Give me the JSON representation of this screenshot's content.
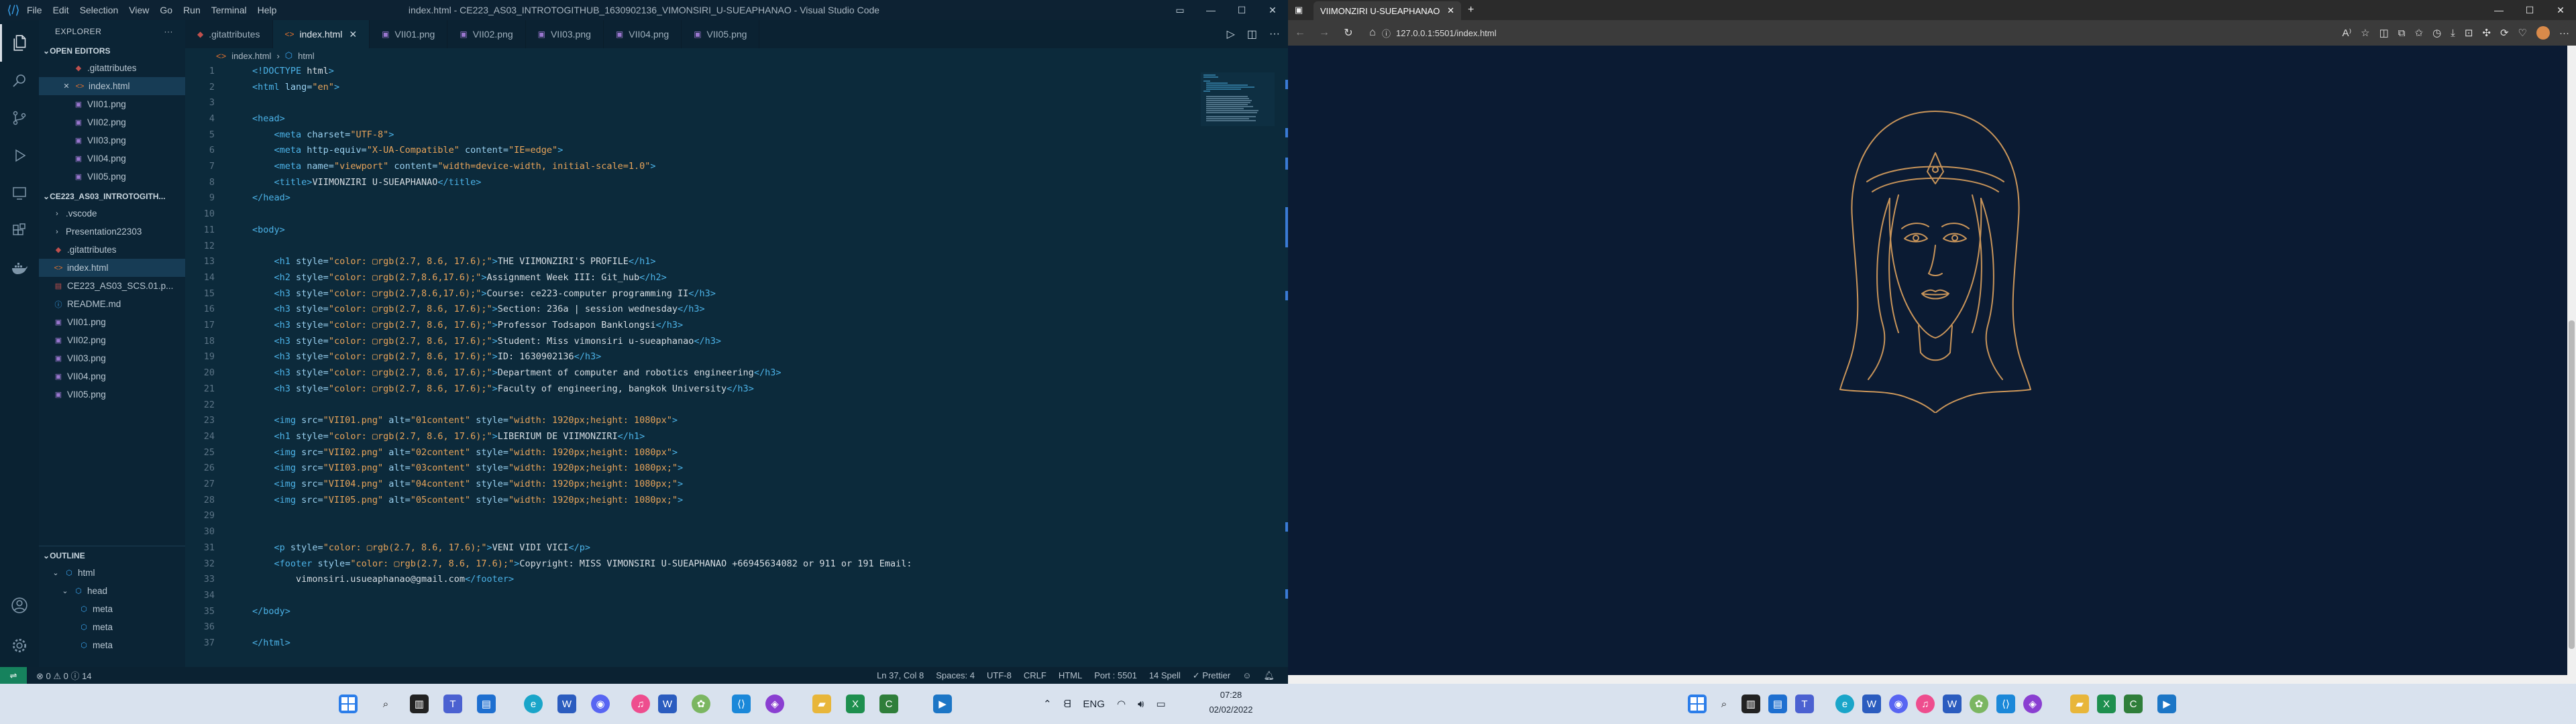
{
  "vscode": {
    "window_title": "index.html - CE223_AS03_INTROTOGITHUB_1630902136_VIMONSIRI_U-SUEAPHANAO - Visual Studio Code",
    "menu": [
      "File",
      "Edit",
      "Selection",
      "View",
      "Go",
      "Run",
      "Terminal",
      "Help"
    ],
    "explorer_title": "EXPLORER",
    "open_editors_title": "OPEN EDITORS",
    "open_editors": [
      ".gitattributes",
      "index.html",
      "VII01.png",
      "VII02.png",
      "VII03.png",
      "VII04.png",
      "VII05.png"
    ],
    "workspace_title": "CE223_AS03_INTROTOGITH...",
    "workspace_items": [
      ".vscode",
      "Presentation22303",
      ".gitattributes",
      "index.html",
      "CE223_AS03_SCS.01.p...",
      "README.md",
      "VII01.png",
      "VII02.png",
      "VII03.png",
      "VII04.png",
      "VII05.png"
    ],
    "outline_title": "OUTLINE",
    "outline_items": [
      "html",
      "head",
      "meta",
      "meta",
      "meta"
    ],
    "tabs": [
      ".gitattributes",
      "index.html",
      "VII01.png",
      "VII02.png",
      "VII03.png",
      "VII04.png",
      "VII05.png"
    ],
    "breadcrumb": [
      "index.html",
      "html"
    ],
    "status": {
      "errors": "⊗ 0 ⚠ 0 ⓘ 14",
      "position": "Ln 37, Col 8",
      "spaces": "Spaces: 4",
      "encoding": "UTF-8",
      "eol": "CRLF",
      "language": "HTML",
      "port": "Port : 5501",
      "spell": "14 Spell",
      "prettier": "✓ Prettier"
    }
  },
  "code_lines": [
    "<!DOCTYPE html>",
    "<html lang=\"en\">",
    "",
    "<head>",
    "    <meta charset=\"UTF-8\">",
    "    <meta http-equiv=\"X-UA-Compatible\" content=\"IE=edge\">",
    "    <meta name=\"viewport\" content=\"width=device-width, initial-scale=1.0\">",
    "    <title>VIIMONZIRI U-SUEAPHANAO</title>",
    "</head>",
    "",
    "<body>",
    "",
    "    <h1 style=\"color: ▢rgb(2.7, 8.6, 17.6);\">THE VIIMONZIRI'S PROFILE</h1>",
    "    <h2 style=\"color: ▢rgb(2.7,8.6,17.6);\">Assignment Week III: Git_hub</h2>",
    "    <h3 style=\"color: ▢rgb(2.7,8.6,17.6);\">Course: ce223-computer programming II</h3>",
    "    <h3 style=\"color: ▢rgb(2.7, 8.6, 17.6);\">Section: 236a | session wednesday</h3>",
    "    <h3 style=\"color: ▢rgb(2.7, 8.6, 17.6);\">Professor Todsapon Banklongsi</h3>",
    "    <h3 style=\"color: ▢rgb(2.7, 8.6, 17.6);\">Student: Miss vimonsiri u-sueaphanao</h3>",
    "    <h3 style=\"color: ▢rgb(2.7, 8.6, 17.6);\">ID: 1630902136</h3>",
    "    <h3 style=\"color: ▢rgb(2.7, 8.6, 17.6);\">Department of computer and robotics engineering</h3>",
    "    <h3 style=\"color: ▢rgb(2.7, 8.6, 17.6);\">Faculty of engineering, bangkok University</h3>",
    "",
    "    <img src=\"VII01.png\" alt=\"01content\" style=\"width: 1920px;height: 1080px\">",
    "    <h1 style=\"color: ▢rgb(2.7, 8.6, 17.6);\">LIBERIUM DE VIIMONZIRI</h1>",
    "    <img src=\"VII02.png\" alt=\"02content\" style=\"width: 1920px;height: 1080px\">",
    "    <img src=\"VII03.png\" alt=\"03content\" style=\"width: 1920px;height: 1080px;\">",
    "    <img src=\"VII04.png\" alt=\"04content\" style=\"width: 1920px;height: 1080px;\">",
    "    <img src=\"VII05.png\" alt=\"05content\" style=\"width: 1920px;height: 1080px;\">",
    "",
    "",
    "    <p style=\"color: ▢rgb(2.7, 8.6, 17.6);\">VENI VIDI VICI</p>",
    "    <footer style=\"color: ▢rgb(2.7, 8.6, 17.6);\">Copyright: MISS VIMONSIRI U-SUEAPHANAO +66945634082 or 911 or 191 Email:",
    "        vimonsiri.usueaphanao@gmail.com</footer>",
    "",
    "</body>",
    "",
    "</html>"
  ],
  "browser": {
    "tab_title": "VIIMONZIRI U-SUEAPHANAO",
    "url": "127.0.0.1:5501/index.html"
  },
  "taskbar": {
    "clock_time": "07:28",
    "clock_date": "02/02/2022",
    "lang": "ENG"
  },
  "colors": {
    "editor_bg": "#0c2a3b",
    "page_bg": "#0b1b33",
    "line_art": "#c9955a",
    "tag": "#4cb3e8",
    "string": "#e8a45a"
  }
}
